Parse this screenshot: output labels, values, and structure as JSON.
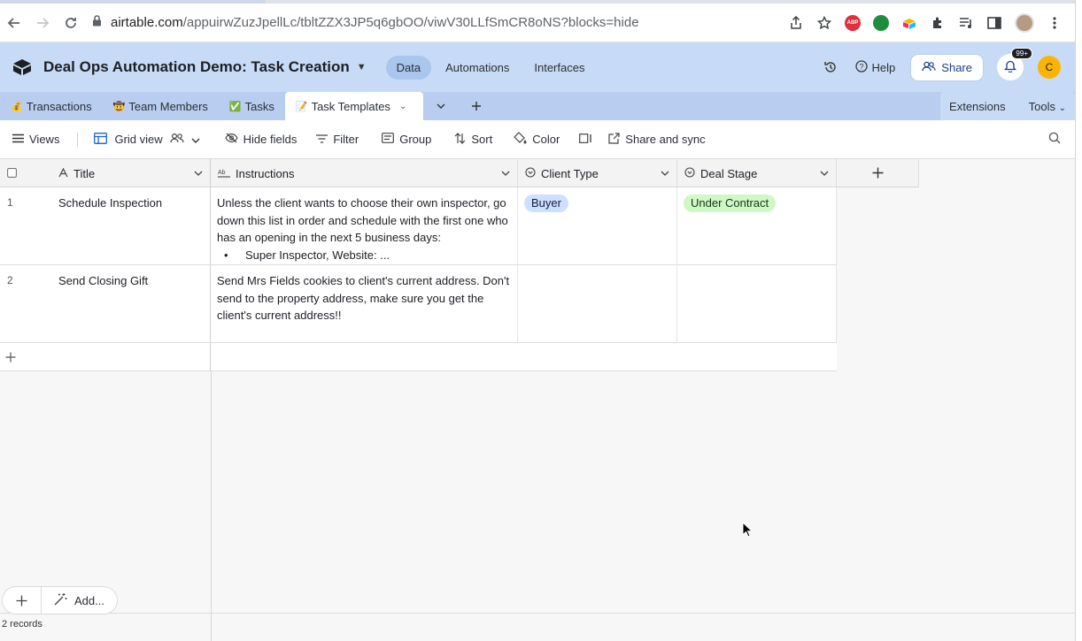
{
  "browser": {
    "url_domain": "airtable.com",
    "url_path": "/appuirwZuzJpellLc/tbltZZX3JP5q6gbOO/viwV30LLfSmCR8oNS?blocks=hide",
    "abp_label": "ABP"
  },
  "header": {
    "base_title": "Deal Ops Automation Demo: Task Creation",
    "tabs": [
      {
        "label": "Data"
      },
      {
        "label": "Automations"
      },
      {
        "label": "Interfaces"
      }
    ],
    "help_label": "Help",
    "share_label": "Share",
    "notification_badge": "99+",
    "avatar_initial": "C"
  },
  "tables": [
    {
      "emoji": "💰",
      "label": "Transactions"
    },
    {
      "emoji": "🤠",
      "label": "Team Members"
    },
    {
      "emoji": "✅",
      "label": "Tasks"
    },
    {
      "emoji": "📝",
      "label": "Task Templates"
    }
  ],
  "tables_bar": {
    "extensions_label": "Extensions",
    "tools_label": "Tools"
  },
  "view_bar": {
    "views_label": "Views",
    "grid_view_label": "Grid view",
    "hide_fields_label": "Hide fields",
    "filter_label": "Filter",
    "group_label": "Group",
    "sort_label": "Sort",
    "color_label": "Color",
    "share_sync_label": "Share and sync"
  },
  "columns": {
    "title": "Title",
    "instructions": "Instructions",
    "client_type": "Client Type",
    "deal_stage": "Deal Stage"
  },
  "rows": [
    {
      "num": "1",
      "title": "Schedule Inspection",
      "instructions": "Unless the client wants to choose their own inspector, go down this list in order and schedule with the first one who has an opening in the next 5 business days:",
      "instructions_bullet": "Super Inspector, Website: ...",
      "client_type": "Buyer",
      "deal_stage": "Under Contract"
    },
    {
      "num": "2",
      "title": "Send Closing Gift",
      "instructions": "Send Mrs Fields cookies to client's current address. Don't send to the property address, make sure you get the client's current address!!",
      "client_type": "",
      "deal_stage": ""
    }
  ],
  "footer": {
    "add_label": "Add...",
    "records_count": "2 records"
  },
  "colors": {
    "header_bg": "#c8dbf6",
    "tables_bar_bg": "#b8cdf0",
    "pill_blue": "#cfdfff",
    "pill_green": "#d1f7c4",
    "avatar": "#fcb400"
  }
}
